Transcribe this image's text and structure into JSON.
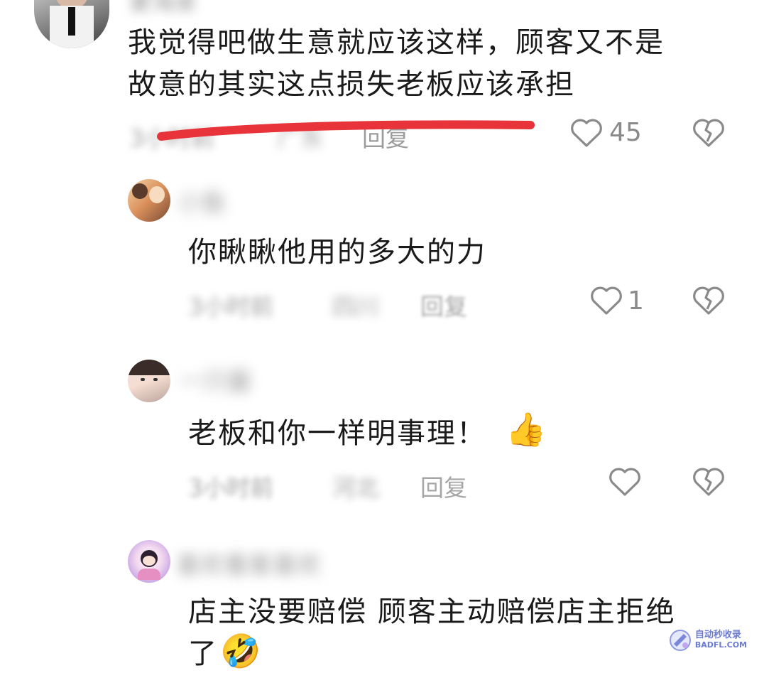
{
  "comments": [
    {
      "user_blurred": "蒙淘家",
      "text_line1": "我觉得吧做生意就应该这样，顾客又不是",
      "text_line2": "故意的其实这点损失老板应该承担",
      "meta_time": "3小时前",
      "meta_loc": "广东",
      "reply": "回复",
      "likes": "45"
    },
    {
      "user_blurred": "小鱼",
      "text": "你瞅瞅他用的多大的力",
      "meta_time": "3小时前",
      "meta_loc": "四川",
      "reply": "回复",
      "likes": "1"
    },
    {
      "user_blurred": "一只暮",
      "text": "老板和你一样明事理！",
      "emoji": "👍",
      "meta_time": "3小时前",
      "meta_loc": "河北",
      "reply": "回复",
      "likes": ""
    },
    {
      "user_blurred": "喜欢看客喜欢",
      "text_line1": "店主没要赔偿 顾客主动赔偿店主拒绝",
      "text_line2": "了",
      "emoji": "🤣"
    }
  ],
  "watermark": {
    "line1": "自动秒收录",
    "line2": "BADFL.COM"
  },
  "colors": {
    "annotation_line": "#e8333a",
    "meta_gray": "#a6a6a6",
    "icon_gray": "#8a8a8a"
  }
}
